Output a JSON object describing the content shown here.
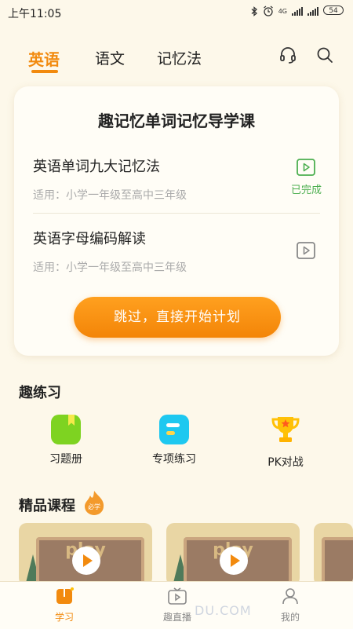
{
  "status": {
    "time": "上午11:05",
    "network": "4G",
    "battery": "54"
  },
  "tabs": [
    {
      "label": "英语",
      "active": true
    },
    {
      "label": "语文",
      "active": false
    },
    {
      "label": "记忆法",
      "active": false
    }
  ],
  "icons": {
    "support": "headset-icon",
    "search": "search-icon"
  },
  "card": {
    "title": "趣记忆单词记忆导学课",
    "lessons": [
      {
        "name": "英语单词九大记忆法",
        "sub": "适用：小学一年级至高中三年级",
        "status": "已完成"
      },
      {
        "name": "英语字母编码解读",
        "sub": "适用：小学一年级至高中三年级",
        "status": ""
      }
    ],
    "start_button": "跳过，直接开始计划"
  },
  "practice": {
    "title": "趣练习",
    "items": [
      {
        "label": "习题册",
        "color": "#7ed321"
      },
      {
        "label": "专项练习",
        "color": "#1ec8f0"
      },
      {
        "label": "PK对战",
        "color": "#ffc107"
      }
    ]
  },
  "courses": {
    "title": "精品课程",
    "badge": "必学",
    "thumbnail_word": "play"
  },
  "nav": [
    {
      "label": "学习",
      "active": true
    },
    {
      "label": "趣直播",
      "active": false
    },
    {
      "label": "我的",
      "active": false
    }
  ],
  "watermark": "DU.COM",
  "colors": {
    "accent": "#f28a0e",
    "done": "#4caf50",
    "background": "#fdf8ea"
  }
}
